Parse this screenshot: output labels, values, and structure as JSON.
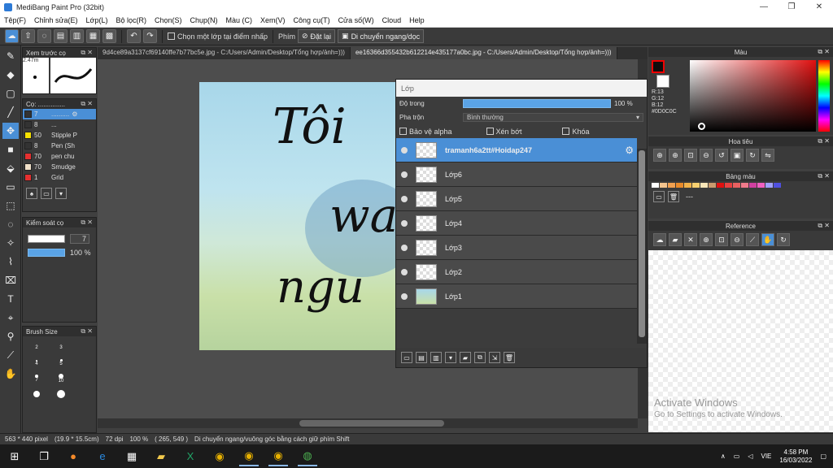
{
  "window": {
    "title": "MediBang Paint Pro (32bit)"
  },
  "menu": [
    "Tệp(F)",
    "Chỉnh sửa(E)",
    "Lớp(L)",
    "Bộ lọc(R)",
    "Chọn(S)",
    "Chụp(N)",
    "Màu (C)",
    "Xem(V)",
    "Công cụ(T)",
    "Cửa số(W)",
    "Cloud",
    "Help"
  ],
  "toolbar": {
    "select_layer_label": "Chọn một lớp tại điểm nhấp",
    "key_label": "Phím",
    "reset_label": "Đặt lại",
    "move_label": "Di chuyển ngang/dọc"
  },
  "preview": {
    "title": "Xem trước cọ",
    "size": "2.47m"
  },
  "brushes": {
    "title": "Cọ: ...............",
    "items": [
      {
        "size": "7",
        "name": "..........",
        "color": "#333333"
      },
      {
        "size": "8",
        "name": "...",
        "color": "#333333"
      },
      {
        "size": "50",
        "name": "Stipple P",
        "color": "#f5e000"
      },
      {
        "size": "8",
        "name": "Pen (Sh",
        "color": "#333333"
      },
      {
        "size": "70",
        "name": "pen chu",
        "color": "#e53030"
      },
      {
        "size": "70",
        "name": "Smudge",
        "color": "#f0e0c8"
      },
      {
        "size": "1",
        "name": "Grid",
        "color": "#e53030"
      }
    ]
  },
  "brush_control": {
    "title": "Kiểm soát cọ",
    "size": "7",
    "opacity": "100 %"
  },
  "brush_size": {
    "title": "Brush Size",
    "labels": [
      "2",
      "3",
      "4",
      "5",
      "7",
      "10"
    ]
  },
  "tabs": [
    "9d4ce89a3137cf69140ffe7b77bc5e.jpg - C:/Users/Admin/Desktop/Tổng hợp/ảnh=)))",
    "ee16366d355432b612214e435177a0bc.jpg - C:/Users/Admin/Desktop/Tổng hợp/ảnh=)))"
  ],
  "canvas_text": {
    "line1": "Tôi",
    "line2": "wa",
    "line3": "ngu"
  },
  "layers_panel": {
    "title": "Lớp",
    "opacity_label": "Độ trong",
    "opacity_value": "100 %",
    "opacity_fraction": 1.0,
    "blend_label": "Pha trộn",
    "blend_value": "Bình thường",
    "protect_alpha": "Bảo vệ alpha",
    "clipping": "Xén bớt",
    "lock": "Khóa",
    "layers": [
      "tramanh6a2tt#Hoidap247",
      "Lớp6",
      "Lớp5",
      "Lớp4",
      "Lớp3",
      "Lớp2",
      "Lớp1"
    ]
  },
  "color_panel": {
    "title": "Màu",
    "r": "R:13",
    "g": "G:12",
    "b": "B:12",
    "hex": "#0D0C0C",
    "current": "#0d0c0c"
  },
  "navigator": {
    "title": "Hoa tiêu"
  },
  "palette": {
    "title": "Bảng màu",
    "colors": [
      "#ffffff",
      "#f4c48e",
      "#f0a050",
      "#e88a2a",
      "#f2b24a",
      "#f7d070",
      "#f8e6b8",
      "#c89a6e",
      "#e01010",
      "#e84040",
      "#e86060",
      "#f07a8a",
      "#d040a0",
      "#f060c0",
      "#a0a0ff",
      "#5050e0"
    ],
    "item": "---"
  },
  "reference": {
    "title": "Reference"
  },
  "watermark": {
    "line1": "Activate Windows",
    "line2": "Go to Settings to activate Windows."
  },
  "status": {
    "size": "563 * 440 pixel",
    "cm": "(19.9 * 15.5cm)",
    "dpi": "72 dpi",
    "zoom": "100 %",
    "coords": "( 265, 549 )",
    "hint": "Di chuyển ngang/vuông góc bằng cách giữ phím Shift"
  },
  "taskbar": {
    "lang": "VIE",
    "time": "4:58 PM",
    "date": "16/03/2022"
  }
}
